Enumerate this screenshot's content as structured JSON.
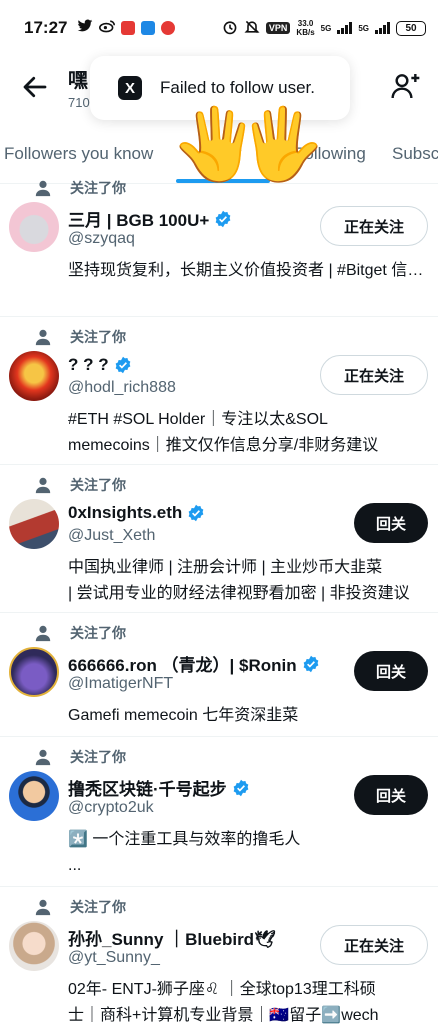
{
  "status_bar": {
    "time": "17:27",
    "vpn_label": "VPN",
    "speed_value": "33.0",
    "speed_unit": "KB/s",
    "signal_label_1": "5G",
    "signal_label_2": "5G",
    "battery": "50"
  },
  "header": {
    "title": "嘿",
    "subtitle": "710",
    "back_icon": "arrow-left-icon",
    "add_icon": "add-user-icon"
  },
  "toast": {
    "logo": "X",
    "message": "Failed to follow user."
  },
  "tabs": [
    {
      "label": "Followers you know"
    },
    {
      "label": "w"
    },
    {
      "label": "Following"
    },
    {
      "label": "Subsc"
    }
  ],
  "overlay_emoji": "🖐",
  "users": [
    {
      "follows_you": "关注了你",
      "name": "三月 | BGB 100U+",
      "handle": "@szyqaq",
      "verified": true,
      "button": "正在关注",
      "button_style": "outline",
      "bio": [
        "坚持现货复利，长期主义价值投资者 | #Bitget 信仰者 | Morph 华语区大使 | #Morph"
      ]
    },
    {
      "follows_you": "关注了你",
      "name": "? ? ?",
      "handle": "@hodl_rich888",
      "verified": true,
      "button": "正在关注",
      "button_style": "outline",
      "bio": [
        "#ETH #SOL Holder｜专注以太&SOL",
        "memecoins｜推文仅作信息分享/非财务建议"
      ]
    },
    {
      "follows_you": "关注了你",
      "name": "0xInsights.eth",
      "handle": "@Just_Xeth",
      "verified": true,
      "button": "回关",
      "button_style": "dark",
      "bio": [
        "中国执业律师 | 注册会计师 | 主业炒币大韭菜",
        "| 尝试用专业的财经法律视野看加密 | 非投资建议"
      ]
    },
    {
      "follows_you": "关注了你",
      "name": "666666.ron （青龙）| $Ronin",
      "handle": "@ImatigerNFT",
      "verified": true,
      "button": "回关",
      "button_style": "dark",
      "bio": [
        "Gamefi memecoin 七年资深韭菜"
      ]
    },
    {
      "follows_you": "关注了你",
      "name": "撸秃区块链·千号起步",
      "handle": "@crypto2uk",
      "verified": true,
      "button": "回关",
      "button_style": "dark",
      "bio": [
        "*️⃣ 一个注重工具与效率的撸毛人",
        "..."
      ]
    },
    {
      "follows_you": "关注了你",
      "name": "孙孙_Sunny ｜Bluebird🕊",
      "handle": "@yt_Sunny_",
      "verified": false,
      "button": "正在关注",
      "button_style": "outline",
      "bio": [
        "02年- ENTJ-狮子座♌ ｜全球top13理工科硕",
        "士｜商科+计算机专业背景｜🇦🇺留子➡️wech"
      ]
    }
  ],
  "colors": {
    "accent": "#1d9bf0",
    "text": "#0f1419",
    "muted": "#536471",
    "divider": "#eff3f4"
  }
}
